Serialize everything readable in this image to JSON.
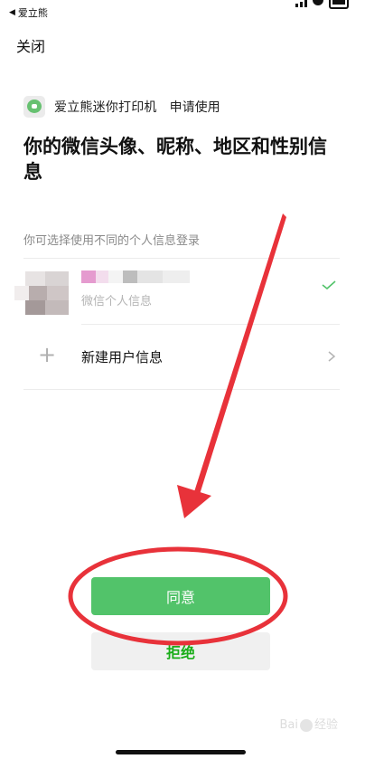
{
  "status_bar": {
    "back_app": "爱立熊",
    "back_arrow": "◀"
  },
  "header": {
    "close_label": "关闭"
  },
  "app": {
    "icon": "chat-bubble-icon",
    "name": "爱立熊迷你打印机",
    "request_label": "申请使用"
  },
  "title": "你的微信头像、昵称、地区和性别信息",
  "hint": "你可选择使用不同的个人信息登录",
  "profile_option": {
    "subtitle": "微信个人信息",
    "selected": true
  },
  "new_option": {
    "icon": "plus-icon",
    "label": "新建用户信息"
  },
  "buttons": {
    "agree_label": "同意",
    "reject_label": "拒绝"
  },
  "colors": {
    "agree_bg": "#52c36a",
    "reject_text": "#1aad19",
    "annotation_red": "#e8323a"
  },
  "watermark": {
    "text_a": "Bai",
    "text_b": "经验"
  }
}
